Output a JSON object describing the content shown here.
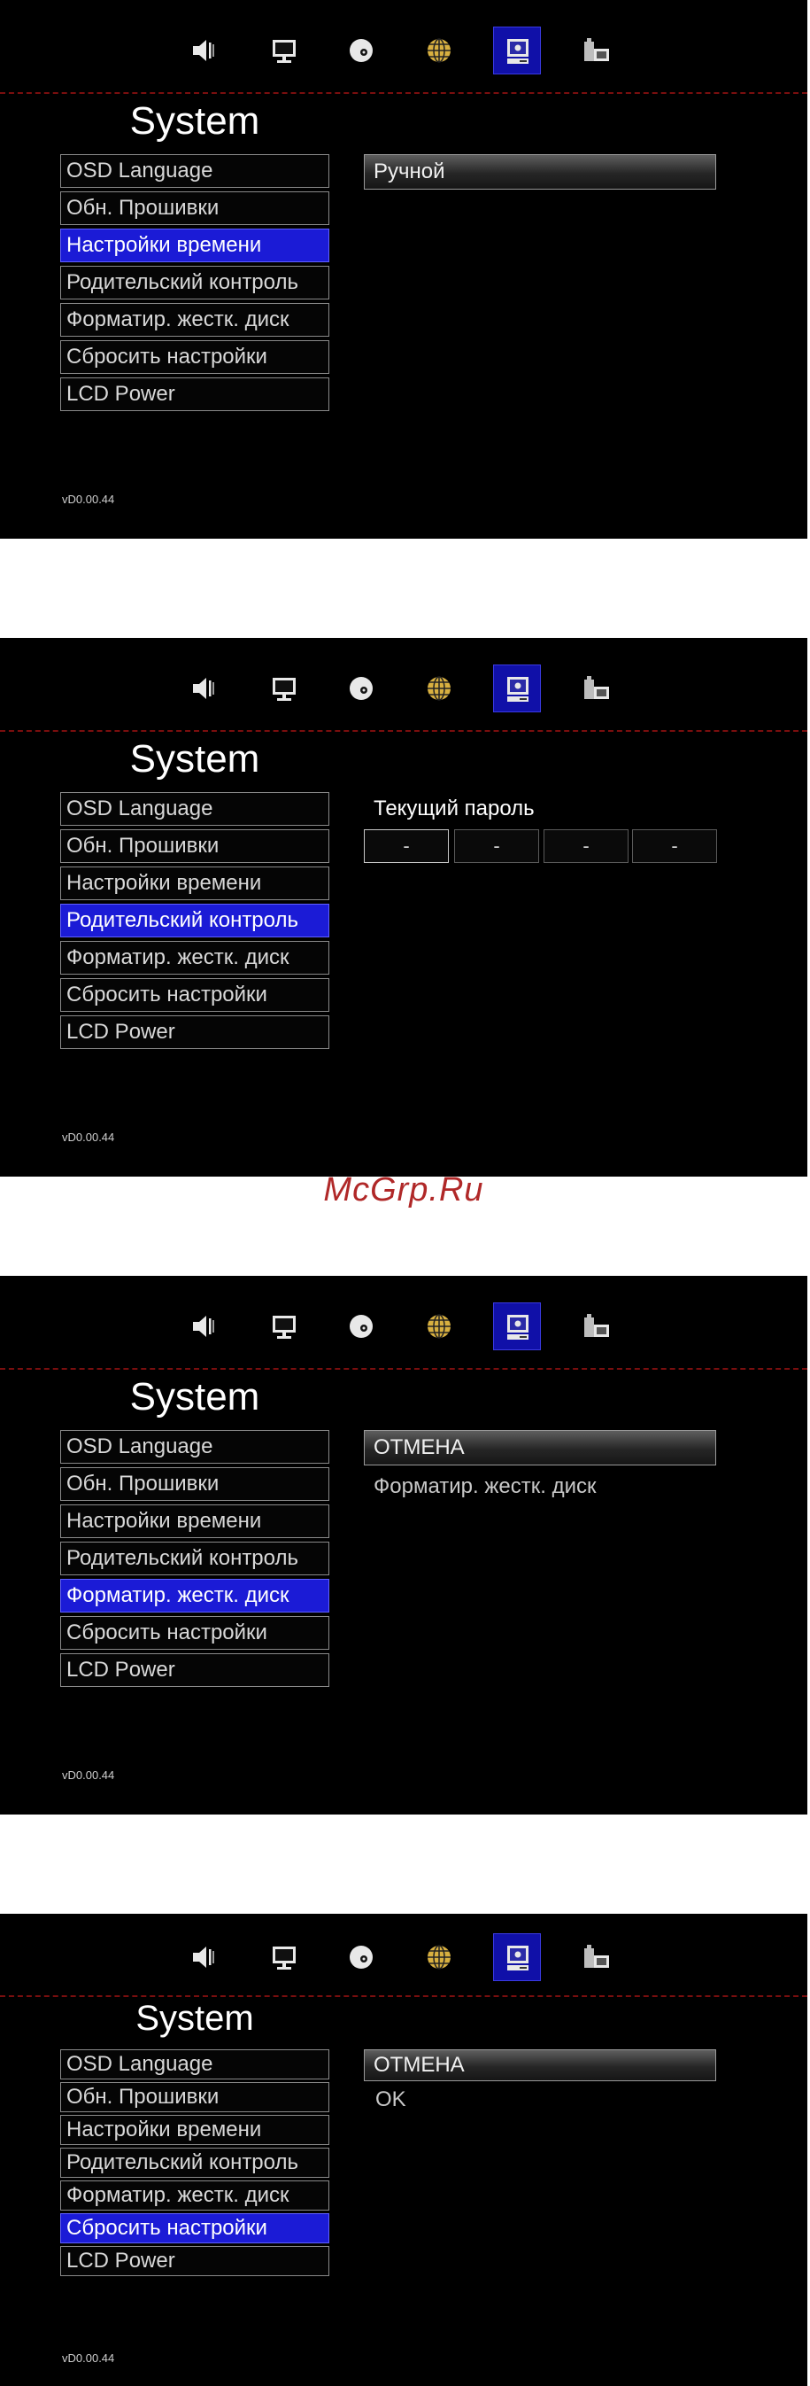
{
  "toolbar_icons": [
    "speaker-icon",
    "monitor-icon",
    "disc-icon",
    "globe-icon",
    "system-icon",
    "info-icon"
  ],
  "menu_items": [
    "OSD Language",
    "Обн. Прошивки",
    "Настройки времени",
    "Родительский контроль",
    "Форматир. жестк. диск",
    "Сбросить настройки",
    "LCD Power"
  ],
  "screens": [
    {
      "title": "System",
      "selected_index": 2,
      "option_box": "Ручной",
      "version": "vD0.00.44"
    },
    {
      "title": "System",
      "selected_index": 3,
      "password_label": "Текущий пароль",
      "password_slots": [
        "-",
        "-",
        "-",
        "-"
      ],
      "version": "vD0.00.44"
    },
    {
      "title": "System",
      "selected_index": 4,
      "option_box": "ОТМЕНА",
      "option_text": "Форматир. жестк. диск",
      "version": "vD0.00.44"
    },
    {
      "title": "System",
      "selected_index": 5,
      "option_box": "ОТМЕНА",
      "option_text": "OK",
      "version": "vD0.00.44"
    }
  ],
  "watermark": "McGrp.Ru",
  "colors": {
    "screen_bg": "#000000",
    "selection": "#1b1bd6",
    "active_icon_bg": "#1010a8",
    "divider": "#7a0e0e",
    "watermark": "#b02828"
  }
}
